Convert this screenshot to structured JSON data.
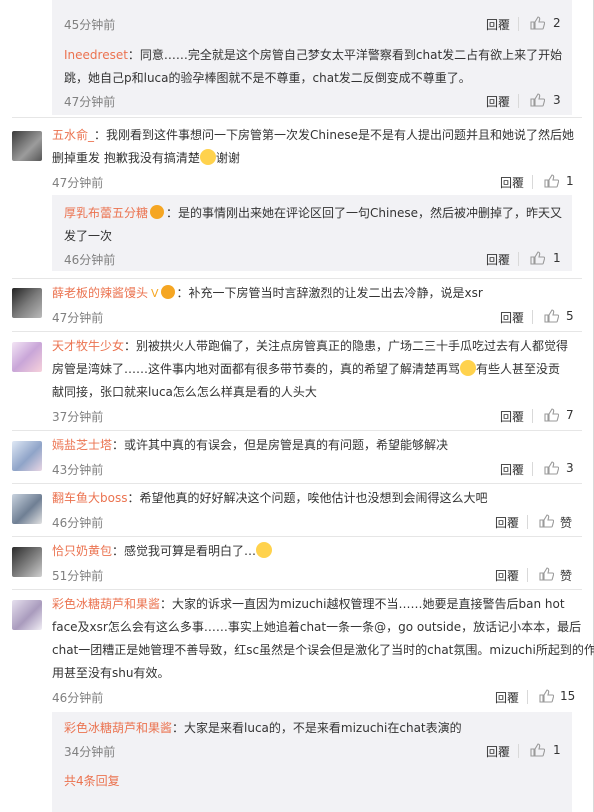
{
  "thread": {
    "top_reply_time": "45分钟前",
    "reply_label": "回覆",
    "reply_label_alt": "回覆",
    "items": [
      {
        "user": "Ineedreset",
        "text1": "：同意……完全就是这个房管自己梦女太平洋警察看到chat发二占有欲上来了开始",
        "text2": "跳，她自己p和luca的验孕棒图就不是不尊重，chat发二反倒变成不尊重了。",
        "time": "47分钟前",
        "likes": "3"
      },
      {
        "user": "五水俞_",
        "text1": "：我刚看到这件事想问一下房管第一次发Chinese是不是有人提出问题并且和她说了然后她",
        "text2": "删掉重发 抱歉我没有搞清楚",
        "text2_tail": "谢谢",
        "time": "47分钟前",
        "likes": "1"
      },
      {
        "user": "厚乳布蕾五分糖",
        "text1": "：是的事情刚出来她在评论区回了一句Chinese，然后被冲删掉了，昨天又",
        "text2": "发了一次",
        "time": "46分钟前",
        "likes": "1"
      },
      {
        "user": "薛老板的辣酱馒头",
        "vmark": "V",
        "text1": "：补充一下房管当时言辞激烈的让发二出去冷静，说是xsr",
        "time": "47分钟前",
        "likes": "5"
      },
      {
        "user": "天才牧牛少女",
        "text1": "：别被拱火人带跑偏了，关注点房管真正的隐患，广场二三十手瓜吃过去有人都觉得",
        "text2": "房管是湾妹了……这件事内地对面都有很多带节奏的，真的希望了解清楚再骂",
        "text2_tail": "有些人甚至没贡",
        "text3": "献同接，张口就来luca怎么怎么样真是看的人头大",
        "time": "37分钟前",
        "likes": "7"
      },
      {
        "user": "嫣盐芝士塔",
        "text1": "：或许其中真的有误会，但是房管是真的有问题，希望能够解决",
        "time": "43分钟前",
        "likes": "3"
      },
      {
        "user": "翻车鱼大boss",
        "text1": "：希望他真的好好解决这个问题，唉他估计也没想到会闹得这么大吧",
        "time": "46分钟前",
        "likes": "赞"
      },
      {
        "user": "恰只奶黄包",
        "text1": "：感觉我可算是看明白了…",
        "time": "51分钟前",
        "likes": "赞"
      },
      {
        "user": "彩色冰糖葫芦和果酱",
        "text1": "：大家的诉求一直因为mizuchi越权管理不当……她要是直接警告后ban hot",
        "text2": "face及xsr怎么会有这么多事……事实上她追着chat一条一条@，go outside，放话记小本本，最后",
        "text3": "chat一团糟正是她管理不善导致，红sc虽然是个误会但是激化了当时的chat氛围。mizuchi所起到的作",
        "text4": "用甚至没有shu有效。",
        "time": "46分钟前",
        "likes": "15"
      },
      {
        "user": "彩色冰糖葫芦和果酱",
        "text1": "：大家是来看luca的，不是来看mizuchi在chat表演的",
        "time": "34分钟前",
        "likes": "1"
      }
    ],
    "top_likes": "2",
    "more_replies": "共4条回复"
  }
}
